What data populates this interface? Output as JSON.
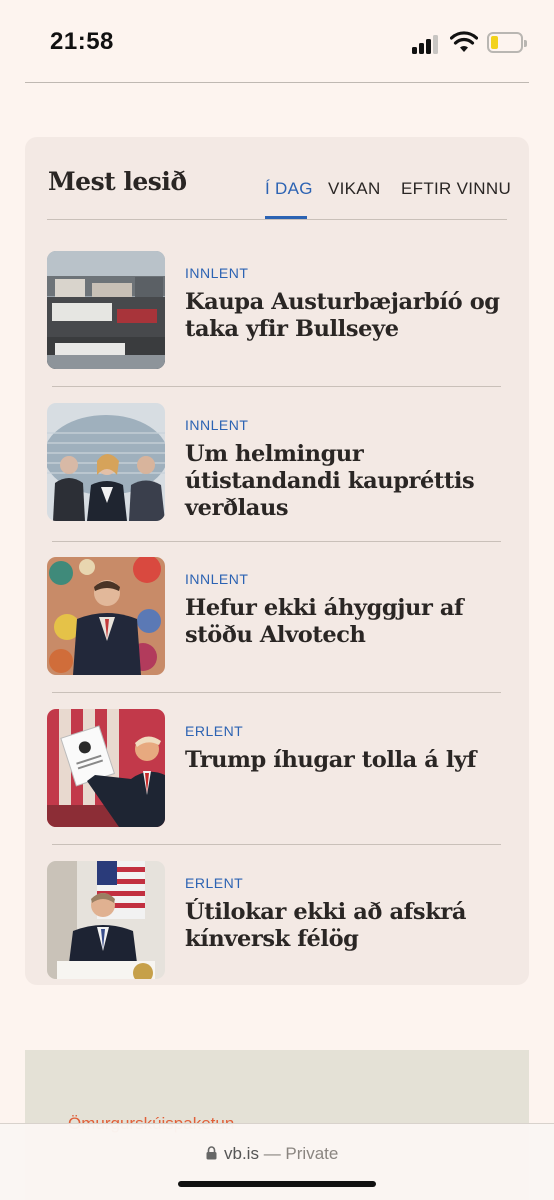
{
  "status_bar": {
    "time": "21:58"
  },
  "card": {
    "title": "Mest lesið",
    "tabs": [
      {
        "label": "Í DAG",
        "active": true
      },
      {
        "label": "VIKAN",
        "active": false
      },
      {
        "label": "EFTIR VINNU",
        "active": false
      }
    ],
    "articles": [
      {
        "category": "INNLENT",
        "headline": "Kaupa Austurbæjarbíó og taka yfir Bullseye"
      },
      {
        "category": "INNLENT",
        "headline": "Um helmingur útistandandi kaupréttis verðlaus"
      },
      {
        "category": "INNLENT",
        "headline": "Hefur ekki áhyggjur af stöðu Alvotech"
      },
      {
        "category": "ERLENT",
        "headline": "Trump íhugar tolla á lyf"
      },
      {
        "category": "ERLENT",
        "headline": "Útilokar ekki að afskrá kínversk félög"
      }
    ]
  },
  "promo": {
    "text": "Ömurgurskúispaketun"
  },
  "url_bar": {
    "domain": "vb.is",
    "suffix": " — Private"
  },
  "colors": {
    "accent": "#2c63b3",
    "background": "#fdf4ef",
    "card": "#f3e9e4"
  }
}
